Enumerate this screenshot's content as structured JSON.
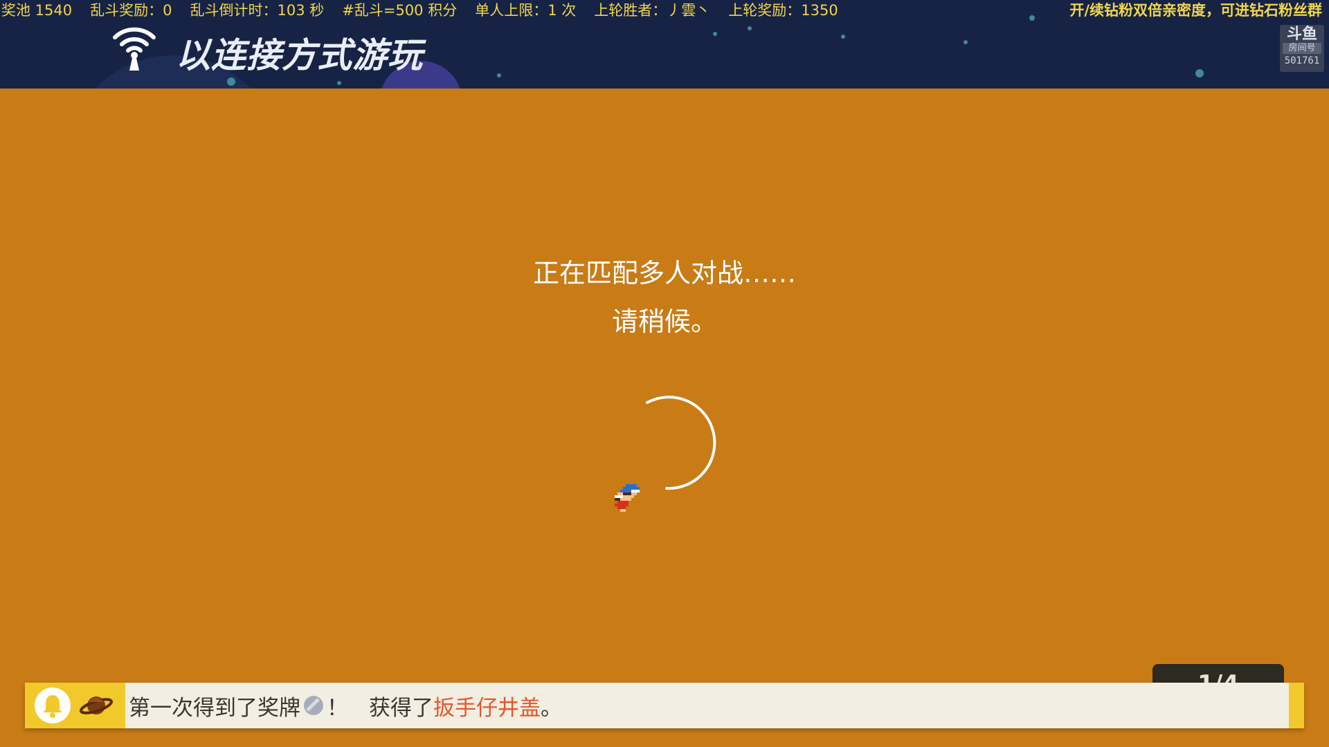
{
  "ticker": {
    "pool": "奖池 1540",
    "brawl_reward": "乱斗奖励：0",
    "countdown": "乱斗倒计时：103 秒",
    "points": "#乱斗=500 积分",
    "limit": "单人上限：1 次",
    "last_winner": "上轮胜者：丿雲丶",
    "last_reward": "上轮奖励：1350"
  },
  "promo": "开/续钻粉双倍亲密度，可进钻石粉丝群",
  "header": {
    "title": "以连接方式游玩",
    "wifi_icon": "wifi-antenna-icon"
  },
  "room": {
    "logo": "斗鱼",
    "label": "房间号",
    "number": "501761"
  },
  "status": {
    "line1": "正在匹配多人对战……",
    "line2": "请稍候。"
  },
  "spinner": {
    "icon": "loading-arc-icon",
    "color": "#ffffff"
  },
  "sprite": {
    "icon": "mario-sprite-icon"
  },
  "page_indicator": "1/4",
  "notification": {
    "part1": "第一次得到了奖牌",
    "medal_icon": "silver-medal-icon",
    "part2": "！",
    "part3": "获得了",
    "item": "扳手仔井盖",
    "part4": "。",
    "bell_icon": "bell-icon",
    "planet_icon": "planet-icon"
  },
  "colors": {
    "background": "#c97b16",
    "header": "#172345",
    "ticker_text": "#f2d64a",
    "notify_accent": "#f1c92a",
    "item_highlight": "#e8552a"
  }
}
